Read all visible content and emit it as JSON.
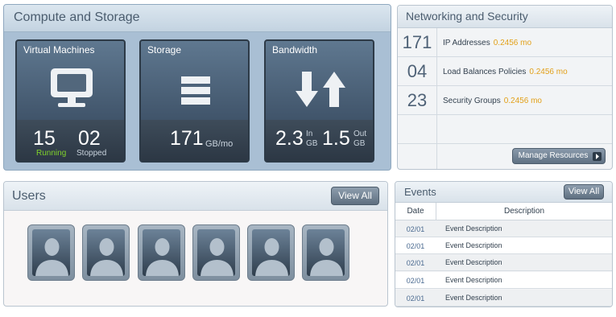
{
  "compute": {
    "title": "Compute and Storage",
    "vm": {
      "title": "Virtual Machines",
      "running_count": "15",
      "running_label": "Running",
      "stopped_count": "02",
      "stopped_label": "Stopped",
      "icon": "monitor-icon"
    },
    "storage": {
      "title": "Storage",
      "value": "171",
      "unit": "GB/mo",
      "icon": "storage-icon"
    },
    "bandwidth": {
      "title": "Bandwidth",
      "in_value": "2.3",
      "in_label": "In",
      "in_unit": "GB",
      "out_value": "1.5",
      "out_label": "Out",
      "out_unit": "GB",
      "icon": "transfer-arrows-icon"
    }
  },
  "network": {
    "title": "Networking and Security",
    "rows": [
      {
        "count": "171",
        "label": "IP Addresses",
        "value": "0.2456 mo"
      },
      {
        "count": "04",
        "label": "Load Balances Policies",
        "value": "0.2456 mo"
      },
      {
        "count": "23",
        "label": "Security Groups",
        "value": "0.2456 mo"
      }
    ],
    "manage_label": "Manage Resources"
  },
  "users": {
    "title": "Users",
    "view_all": "View All",
    "avatar_count": 6
  },
  "events": {
    "title": "Events",
    "view_all": "View All",
    "columns": [
      "Date",
      "Description"
    ],
    "rows": [
      {
        "date": "02/01",
        "description": "Event Description"
      },
      {
        "date": "02/01",
        "description": "Event Description"
      },
      {
        "date": "02/01",
        "description": "Event Description"
      },
      {
        "date": "02/01",
        "description": "Event Description"
      },
      {
        "date": "02/01",
        "description": "Event Description"
      }
    ]
  },
  "colors": {
    "accent_orange": "#e2a01a",
    "running_green": "#7fd22a",
    "tile_dark": "#2f3b48"
  }
}
